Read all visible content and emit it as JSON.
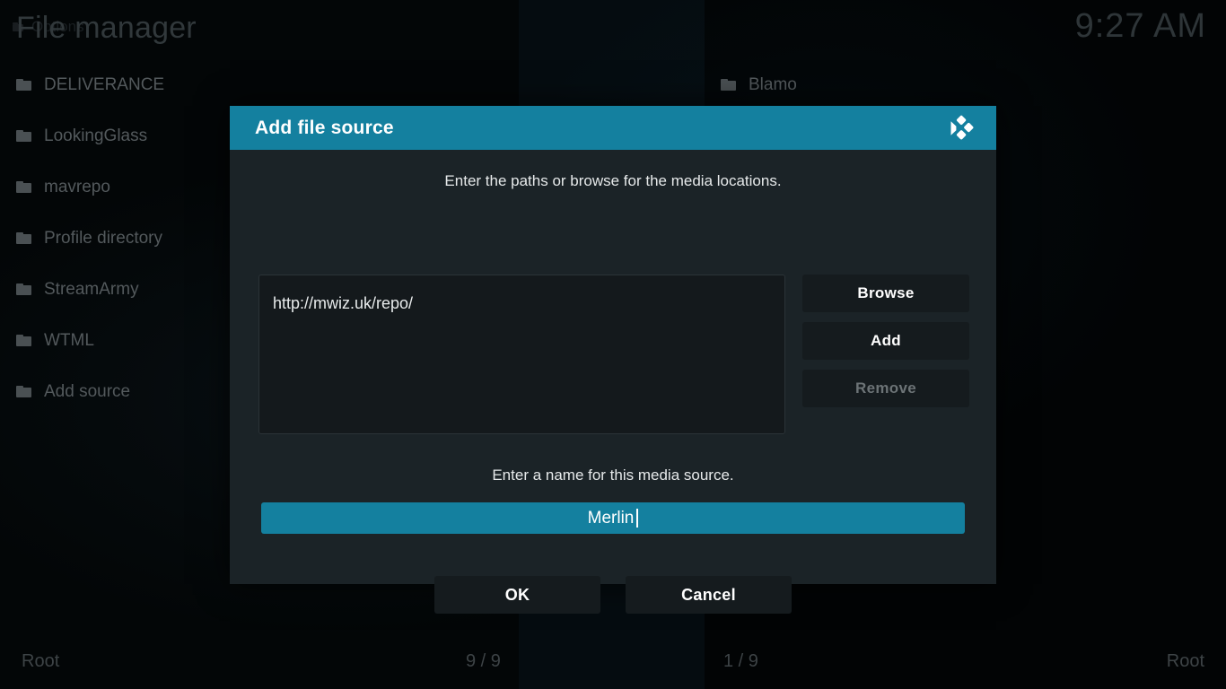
{
  "window": {
    "title": "File manager",
    "ghost_title": "Options",
    "clock": "9:27 AM"
  },
  "panes": {
    "left": {
      "items": [
        {
          "label": "DELIVERANCE",
          "icon": "folder-icon"
        },
        {
          "label": "LookingGlass",
          "icon": "folder-icon"
        },
        {
          "label": "mavrepo",
          "icon": "folder-icon"
        },
        {
          "label": "Profile directory",
          "icon": "folder-icon"
        },
        {
          "label": "StreamArmy",
          "icon": "folder-icon"
        },
        {
          "label": "WTML",
          "icon": "folder-icon"
        },
        {
          "label": "Add source",
          "icon": "folder-icon"
        }
      ]
    },
    "right": {
      "items": [
        {
          "label": "Blamo",
          "icon": "folder-icon"
        }
      ]
    }
  },
  "statusbar": {
    "left_root": "Root",
    "left_count": "9 / 9",
    "right_count": "1 / 9",
    "right_root": "Root"
  },
  "dialog": {
    "title": "Add file source",
    "logo": "kodi-logo",
    "paths_label": "Enter the paths or browse for the media locations.",
    "path_value": "http://mwiz.uk/repo/",
    "buttons": {
      "browse": "Browse",
      "add": "Add",
      "remove": "Remove"
    },
    "remove_disabled": true,
    "name_label": "Enter a name for this media source.",
    "name_value": "Merlin",
    "confirm": {
      "ok": "OK",
      "cancel": "Cancel"
    }
  },
  "colors": {
    "accent": "#14809f",
    "dialog_bg": "#1b2327",
    "button_bg": "#151b1e",
    "text_primary": "#ffffff",
    "text_muted": "#53595c",
    "text_disabled": "#6c7376"
  }
}
